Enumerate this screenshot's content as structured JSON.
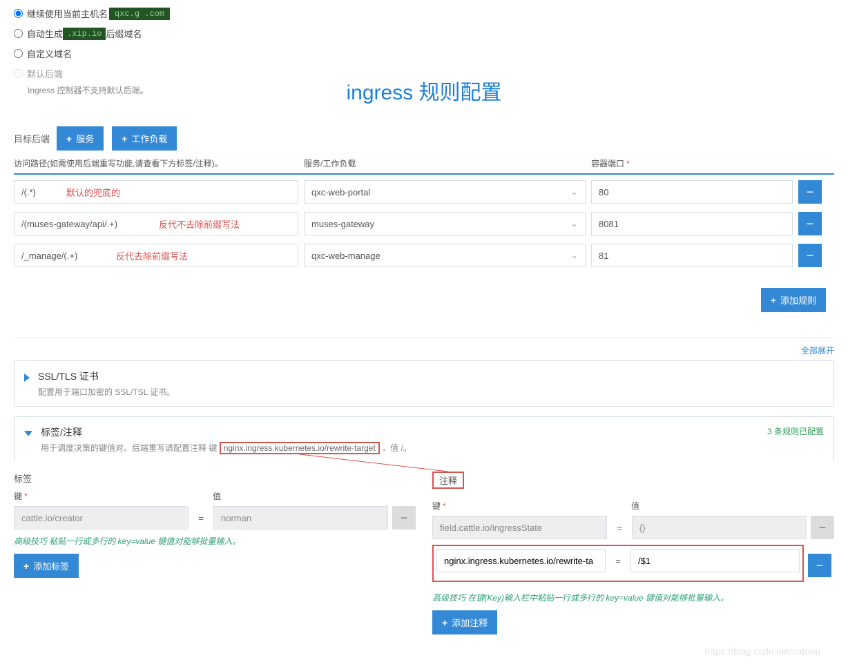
{
  "hostOptions": {
    "keepLabel": "继续使用当前主机名",
    "keepHost": "qxc.g      .com",
    "autoLabel": "自动生成",
    "autoSuffixBadge": ".xip.io",
    "autoTail": "后缀域名",
    "customLabel": "自定义域名",
    "defaultBackendLabel": "默认后端",
    "defaultBackendNote": "Ingress 控制器不支持默认后端。"
  },
  "title": "ingress 规则配置",
  "backend": {
    "label": "目标后端",
    "serviceBtn": "服务",
    "workloadBtn": "工作负载"
  },
  "rules": {
    "pathHeader": "访问路径(如需使用后端重写功能,请查看下方标签/注释)。",
    "svcHeader": "服务/工作负载",
    "portHeader": "容器端口",
    "rows": [
      {
        "path": "/(.*)",
        "note": "默认的兜底的",
        "noteLeft": 76,
        "svc": "qxc-web-portal",
        "port": "80"
      },
      {
        "path": "/(muses-gateway/api/.+)",
        "note": "反代不去除前缀写法",
        "noteLeft": 210,
        "svc": "muses-gateway",
        "port": "8081"
      },
      {
        "path": "/_manage/(.+)",
        "note": "反代去除前缀写法",
        "noteLeft": 148,
        "svc": "qxc-web-manage",
        "port": "81"
      }
    ],
    "addRuleBtn": "添加规则"
  },
  "expandAll": "全部展开",
  "ssl": {
    "title": "SSL/TLS 证书",
    "sub": "配置用于端口加密的 SSL/TSL 证书。"
  },
  "labels": {
    "title": "标签/注释",
    "subPrefix": "用于调度决策的键值对。后端重写请配置注释 键",
    "subKey": "nginx.ingress.kubernetes.io/rewrite-target",
    "subSuffix": "，值 /。",
    "configured": "3 条规则已配置"
  },
  "kv": {
    "labelsTitle": "标签",
    "annoTitle": "注释",
    "keyHdr": "键",
    "valHdr": "值",
    "eq": "=",
    "labelRows": [
      {
        "key": "cattle.io/creator",
        "val": "norman",
        "disabled": true
      }
    ],
    "annoRows": [
      {
        "key": "field.cattle.io/ingressState",
        "val": "{}",
        "disabled": true
      },
      {
        "key": "nginx.ingress.kubernetes.io/rewrite-ta",
        "val": "/$1",
        "disabled": false,
        "boxed": true
      }
    ],
    "labelTip": "高级技巧 粘贴一行或多行的 key=value 键值对能够批量输入。",
    "annoTip": "高级技巧 在键(Key)输入栏中粘贴一行或多行的 key=value 键值对能够批量输入。",
    "addLabelBtn": "添加标签",
    "addAnnoBtn": "添加注释"
  },
  "watermark": "https://blog.csdn.net/catoop"
}
